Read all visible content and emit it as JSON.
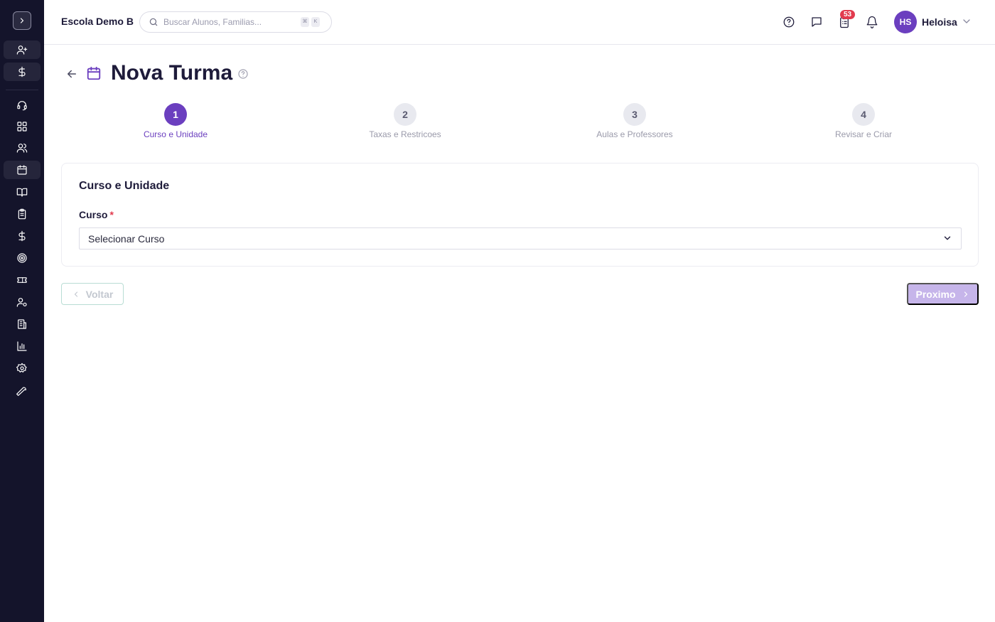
{
  "header": {
    "school_name": "Escola Demo B",
    "search_placeholder": "Buscar Alunos, Familias...",
    "shortcut_keys": [
      "⌘",
      "K"
    ],
    "notification_count": "53",
    "user_initials": "HS",
    "user_name": "Heloisa"
  },
  "sidebar": {
    "items": [
      {
        "icon": "user-plus-icon"
      },
      {
        "icon": "dollar-icon"
      },
      {
        "icon": "headset-icon"
      },
      {
        "icon": "dashboard-icon"
      },
      {
        "icon": "users-icon"
      },
      {
        "icon": "calendar-icon"
      },
      {
        "icon": "book-icon"
      },
      {
        "icon": "clipboard-icon"
      },
      {
        "icon": "dollar-icon"
      },
      {
        "icon": "target-icon"
      },
      {
        "icon": "ticket-icon"
      },
      {
        "icon": "user-settings-icon"
      },
      {
        "icon": "building-icon"
      },
      {
        "icon": "bar-chart-icon"
      },
      {
        "icon": "gear-icon"
      },
      {
        "icon": "wrench-icon"
      }
    ]
  },
  "page": {
    "title": "Nova Turma"
  },
  "steps": [
    {
      "number": "1",
      "label": "Curso e Unidade",
      "state": "active"
    },
    {
      "number": "2",
      "label": "Taxas e Restricoes",
      "state": "inactive"
    },
    {
      "number": "3",
      "label": "Aulas e Professores",
      "state": "inactive"
    },
    {
      "number": "4",
      "label": "Revisar e Criar",
      "state": "inactive"
    }
  ],
  "form": {
    "section_title": "Curso e Unidade",
    "course_label": "Curso",
    "required_mark": "*",
    "course_value": "Selecionar Curso"
  },
  "actions": {
    "back_label": "Voltar",
    "next_label": "Proximo"
  },
  "colors": {
    "sidebar_bg": "#14142b",
    "accent": "#6b3fbf",
    "badge": "#e23b4e"
  }
}
